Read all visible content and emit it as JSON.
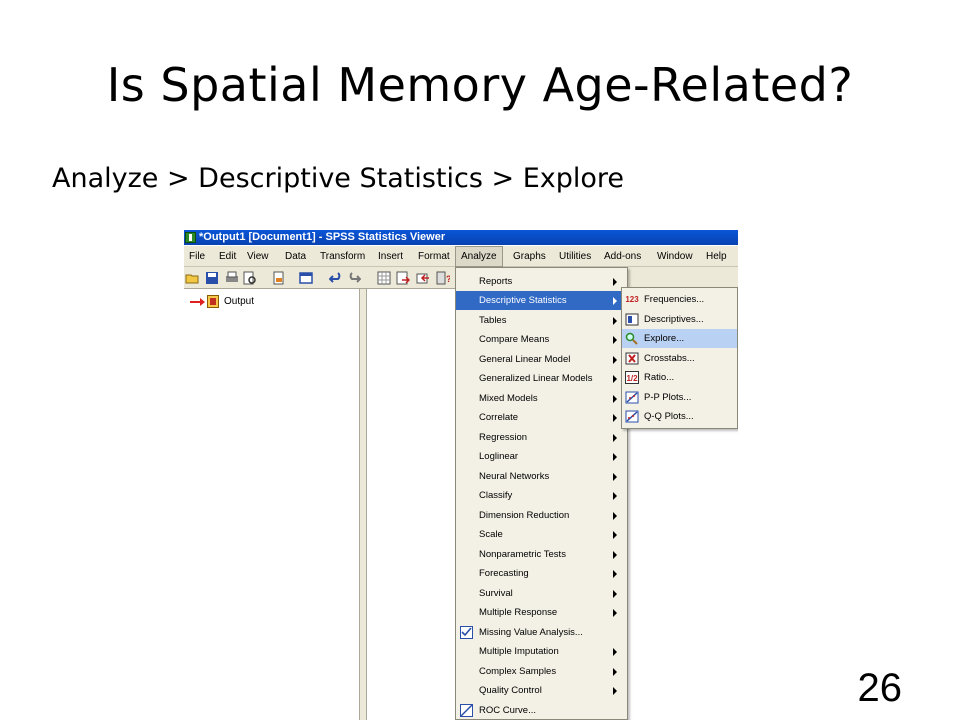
{
  "slide": {
    "title": "Is Spatial Memory Age-Related?",
    "subtitle": "Analyze > Descriptive Statistics > Explore",
    "page_number": "26"
  },
  "window": {
    "title": "*Output1 [Document1] - SPSS Statistics Viewer"
  },
  "menubar": [
    {
      "label": "File"
    },
    {
      "label": "Edit"
    },
    {
      "label": "View"
    },
    {
      "label": "Data"
    },
    {
      "label": "Transform"
    },
    {
      "label": "Insert"
    },
    {
      "label": "Format"
    },
    {
      "label": "Analyze"
    },
    {
      "label": "Graphs"
    },
    {
      "label": "Utilities"
    },
    {
      "label": "Add-ons"
    },
    {
      "label": "Window"
    },
    {
      "label": "Help"
    }
  ],
  "navigator": {
    "output_label": "Output"
  },
  "analyze_menu": [
    {
      "label": "Reports",
      "submenu": true
    },
    {
      "label": "Descriptive Statistics",
      "submenu": true
    },
    {
      "label": "Tables",
      "submenu": true
    },
    {
      "label": "Compare Means",
      "submenu": true
    },
    {
      "label": "General Linear Model",
      "submenu": true
    },
    {
      "label": "Generalized Linear Models",
      "submenu": true
    },
    {
      "label": "Mixed Models",
      "submenu": true
    },
    {
      "label": "Correlate",
      "submenu": true
    },
    {
      "label": "Regression",
      "submenu": true
    },
    {
      "label": "Loglinear",
      "submenu": true
    },
    {
      "label": "Neural Networks",
      "submenu": true
    },
    {
      "label": "Classify",
      "submenu": true
    },
    {
      "label": "Dimension Reduction",
      "submenu": true
    },
    {
      "label": "Scale",
      "submenu": true
    },
    {
      "label": "Nonparametric Tests",
      "submenu": true
    },
    {
      "label": "Forecasting",
      "submenu": true
    },
    {
      "label": "Survival",
      "submenu": true
    },
    {
      "label": "Multiple Response",
      "submenu": true
    },
    {
      "label": "Missing Value Analysis...",
      "submenu": false
    },
    {
      "label": "Multiple Imputation",
      "submenu": true
    },
    {
      "label": "Complex Samples",
      "submenu": true
    },
    {
      "label": "Quality Control",
      "submenu": true
    },
    {
      "label": "ROC Curve...",
      "submenu": false
    }
  ],
  "descriptive_submenu": [
    {
      "label": "Frequencies...",
      "icon": "123"
    },
    {
      "label": "Descriptives...",
      "icon": "descriptives-icon"
    },
    {
      "label": "Explore...",
      "icon": "explore-icon"
    },
    {
      "label": "Crosstabs...",
      "icon": "crosstabs-icon"
    },
    {
      "label": "Ratio...",
      "icon": "1/2"
    },
    {
      "label": "P-P Plots...",
      "icon": "pp-plot-icon"
    },
    {
      "label": "Q-Q Plots...",
      "icon": "qq-plot-icon"
    }
  ],
  "colors": {
    "titlebar": "#0a56d8",
    "menu_highlight": "#316ac5",
    "submenu_highlight": "#b9d1f2"
  }
}
